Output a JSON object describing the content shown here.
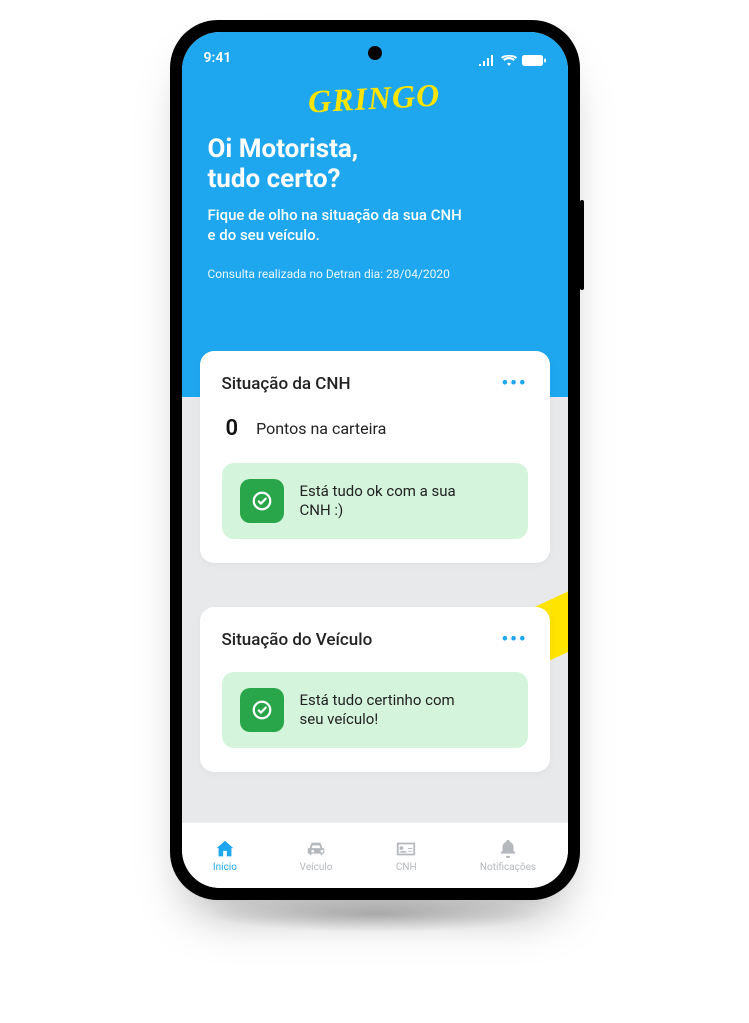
{
  "status_bar": {
    "time": "9:41"
  },
  "header": {
    "logo_text": "GRINGO",
    "greeting_line1": "Oi Motorista,",
    "greeting_line2": "tudo certo?",
    "subtitle_line1": "Fique de olho na situação da sua CNH",
    "subtitle_line2": "e do seu veículo.",
    "consult_info": "Consulta realizada no Detran dia: 28/04/2020"
  },
  "card_cnh": {
    "title": "Situação da CNH",
    "points_value": "0",
    "points_label": "Pontos na carteira",
    "status_text": "Está tudo ok com a sua CNH :)"
  },
  "card_vehicle": {
    "title": "Situação do Veículo",
    "status_text": "Está tudo certinho com seu veículo!"
  },
  "bottom_nav": {
    "home": "Início",
    "vehicle": "Veículo",
    "cnh": "CNH",
    "notifications": "Notificações"
  }
}
